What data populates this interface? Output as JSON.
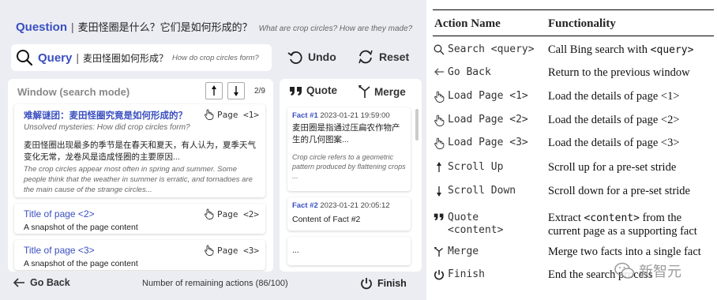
{
  "question": {
    "label": "Question",
    "separator": "|",
    "text_zh": "麦田怪圈是什么？它们是如何形成的？",
    "text_en": "What are crop circles? How are they made?"
  },
  "query": {
    "label": "Query",
    "separator": "|",
    "text_zh": "麦田怪圈如何形成？",
    "text_en": "How do crop circles form?",
    "icon": "search-icon"
  },
  "controls": {
    "undo": "Undo",
    "reset": "Reset"
  },
  "window": {
    "title": "Window (search mode)",
    "page_indicator": "2/9",
    "cards": [
      {
        "title": "难解谜团：麦田怪圈究竟是如何形成的？",
        "subtitle": "Unsolved mysteries: How did crop circles form?",
        "load_label": "Page <1>",
        "snippet_zh": "麦田怪圈出现最多的季节是在春天和夏天，有人认为，夏季天气变化无常，龙卷风是造成怪圈的主要原因...",
        "snippet_en": "The crop circles appear most often in spring and summer. Some people think that the weather in summer is erratic, and tornadoes are the main cause of the strange circles..."
      },
      {
        "title": "Title of page <2>",
        "load_label": "Page <2>",
        "snapshot": "A snapshot of the page content"
      },
      {
        "title": "Title of page <3>",
        "load_label": "Page <3>",
        "snapshot": "A snapshot of the page content"
      }
    ]
  },
  "facts_panel": {
    "quote_label": "Quote",
    "merge_label": "Merge",
    "facts": [
      {
        "id": "Fact #1",
        "timestamp": "2023-01-21 19:59:00",
        "content_zh": "麦田圈是指通过压扁农作物产生的几何图案...",
        "content_en": "Crop circle refers to a geometric pattern produced by flattening crops ..."
      },
      {
        "id": "Fact #2",
        "timestamp": "2023-01-21 20:05:12",
        "content": "Content of Fact #2"
      }
    ],
    "more": "..."
  },
  "bottom": {
    "go_back": "Go Back",
    "remaining": "Number of remaining actions (86/100)",
    "finish": "Finish"
  },
  "table": {
    "headers": [
      "Action Name",
      "Functionality"
    ],
    "rows": [
      {
        "icon": "search-icon",
        "action": "Search <query>",
        "fn_parts": [
          "Call Bing search with ",
          "<query>",
          ""
        ]
      },
      {
        "icon": "arrow-left-icon",
        "action": "Go Back",
        "fn_parts": [
          "Return to the previous window",
          "",
          ""
        ]
      },
      {
        "icon": "hand-pointer-icon",
        "action": "Load Page <1>",
        "fn_parts": [
          "Load the details of  page <1>",
          "",
          ""
        ]
      },
      {
        "icon": "hand-pointer-icon",
        "action": "Load Page <2>",
        "fn_parts": [
          "Load the details of  page <2>",
          "",
          ""
        ]
      },
      {
        "icon": "hand-pointer-icon",
        "action": "Load Page <3>",
        "fn_parts": [
          "Load the details of  page <3>",
          "",
          ""
        ]
      },
      {
        "icon": "arrow-up-icon",
        "action": "Scroll Up",
        "fn_parts": [
          "Scroll up for a pre-set stride",
          "",
          ""
        ]
      },
      {
        "icon": "arrow-down-icon",
        "action": "Scroll Down",
        "fn_parts": [
          "Scroll down for a pre-set stride",
          "",
          ""
        ]
      },
      {
        "icon": "quote-icon",
        "action": "Quote",
        "action2": "<content>",
        "fn_parts": [
          "Extract ",
          "<content>",
          " from the"
        ],
        "fn_line2": "current page as a supporting fact"
      },
      {
        "icon": "merge-icon",
        "action": "Merge",
        "fn_parts": [
          "Merge two facts into a single fact",
          "",
          ""
        ]
      },
      {
        "icon": "power-icon",
        "action": "Finish",
        "fn_parts": [
          "End the search process",
          "",
          ""
        ]
      }
    ]
  },
  "watermark": "新智元",
  "colors": {
    "accent": "#3a4fc0",
    "panel_bg": "#ecedf3"
  }
}
